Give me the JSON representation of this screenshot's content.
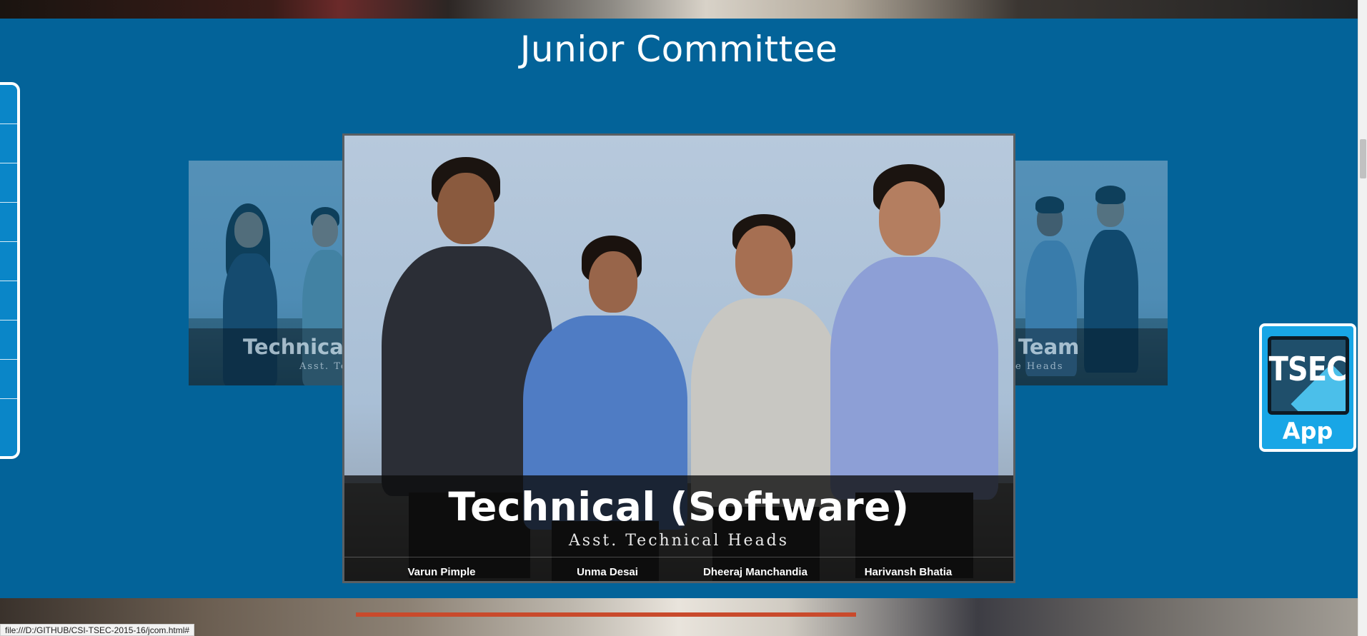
{
  "section": {
    "title": "Junior Committee"
  },
  "side_nav": {
    "item_count": 9
  },
  "carousel": {
    "left_card": {
      "title": "Technica",
      "subtitle": "Asst. Te"
    },
    "main_card": {
      "title": "Technical (Software)",
      "subtitle": "Asst. Technical Heads",
      "members": [
        "Varun Pimple",
        "Unma Desai",
        "Dheeraj Manchandia",
        "Harivansh Bhatia"
      ]
    },
    "right_card": {
      "title": "Team",
      "subtitle": "e Heads"
    }
  },
  "app_badge": {
    "logo": "TSEC",
    "label": "App"
  },
  "status_bar": {
    "url": "file:///D:/GITHUB/CSI-TSEC-2015-16/jcom.html#"
  },
  "colors": {
    "section_bg": "#036399",
    "side_nav_bg": "#0a86c8",
    "badge_bg": "#18a6e6"
  }
}
